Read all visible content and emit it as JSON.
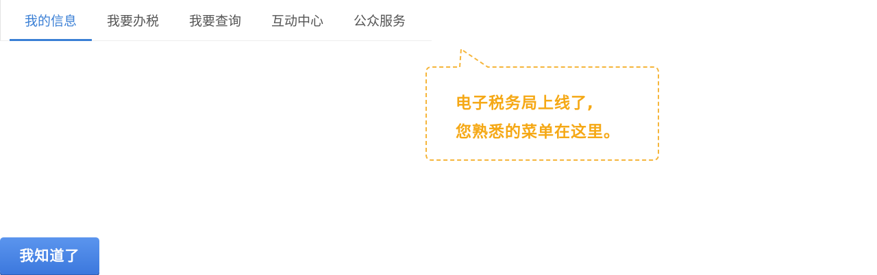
{
  "nav": {
    "tabs": [
      {
        "label": "我的信息",
        "active": true
      },
      {
        "label": "我要办税",
        "active": false
      },
      {
        "label": "我要查询",
        "active": false
      },
      {
        "label": "互动中心",
        "active": false
      },
      {
        "label": "公众服务",
        "active": false
      }
    ]
  },
  "tooltip": {
    "line1": "电子税务局上线了,",
    "line2": "您熟悉的菜单在这里。"
  },
  "button": {
    "label": "我知道了"
  },
  "colors": {
    "accent": "#3a7fd5",
    "tooltip_text": "#f5a815",
    "tooltip_border": "#f5b53a",
    "button": "#4a86e8"
  }
}
